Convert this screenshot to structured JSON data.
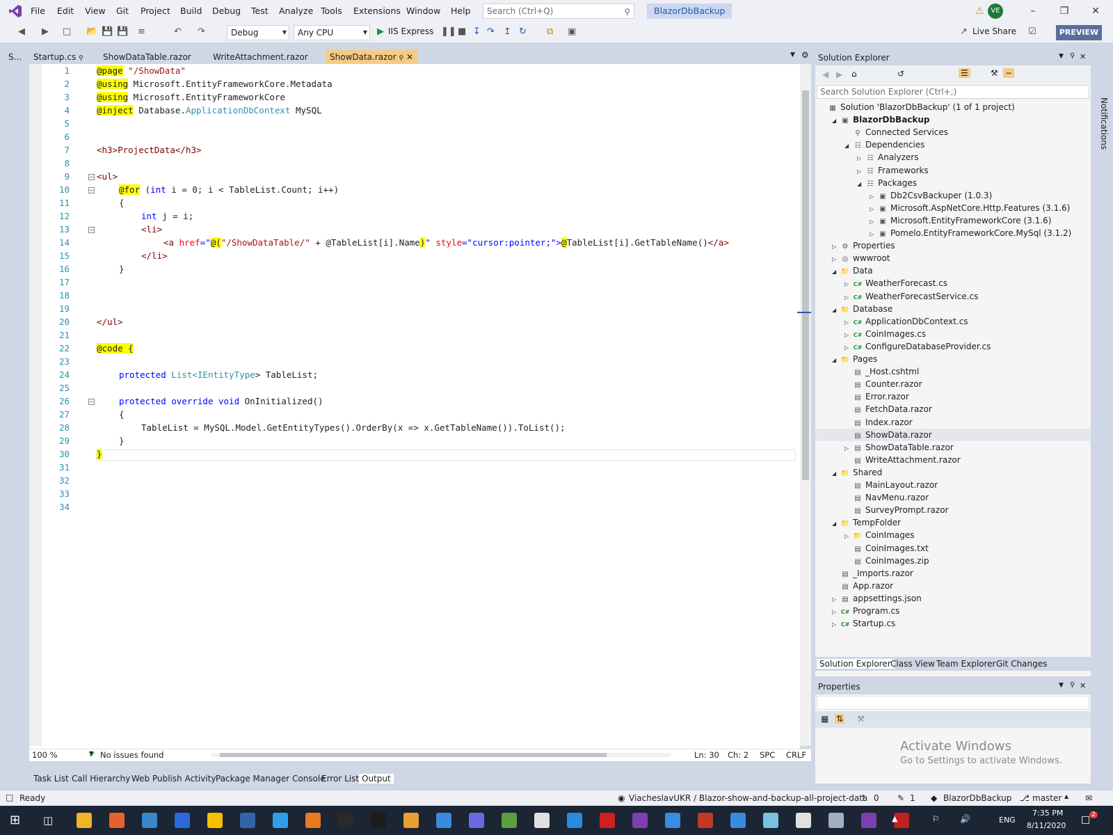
{
  "menu": [
    "File",
    "Edit",
    "View",
    "Git",
    "Project",
    "Build",
    "Debug",
    "Test",
    "Analyze",
    "Tools",
    "Extensions",
    "Window",
    "Help"
  ],
  "search": {
    "placeholder": "Search (Ctrl+Q)"
  },
  "solution_title": "BlazorDbBackup",
  "avatar": "VE",
  "toolbar": {
    "config": "Debug",
    "platform": "Any CPU",
    "run": "IIS Express",
    "live_share": "Live Share",
    "preview": "PREVIEW"
  },
  "tabs": {
    "side": "S...",
    "startup": "Startup.cs",
    "showdatatable": "ShowDataTable.razor",
    "writeattachment": "WriteAttachment.razor",
    "showdata": "ShowData.razor"
  },
  "code": {
    "l1a": "@page",
    "l1b": " \"/ShowData\"",
    "l2a": "@using",
    "l2b": " Microsoft.EntityFrameworkCore.Metadata",
    "l3a": "@using",
    "l3b": " Microsoft.EntityFrameworkCore",
    "l4a": "@inject",
    "l4b": " Database.",
    "l4c": "ApplicationDbContext",
    "l4d": " MySQL",
    "l7": "<h3>ProjectData</h3>",
    "l9": "<ul>",
    "l10a": "@for",
    "l10b": " (",
    "l10c": "int",
    "l10d": " i = 0; i < TableList.Count; i++)",
    "l11": "{",
    "l12a": "int",
    "l12b": " j = i;",
    "l13": "<li>",
    "l14a": "<a ",
    "l14b": "href",
    "l14c": "=\"",
    "l14d": "@(",
    "l14e": "\"/ShowDataTable/\"",
    "l14f": " + @TableList[i].Name",
    "l14g": ")",
    "l14h": "\" ",
    "l14i": "style",
    "l14j": "=\"",
    "l14k": "cursor:pointer;",
    "l14l": "\">",
    "l14m": "@",
    "l14n": "TableList[i].GetTableName()",
    "l14o": "</a>",
    "l15": "</li>",
    "l16": "}",
    "l20": "</ul>",
    "l22a": "@code",
    "l22b": " {",
    "l24a": "protected",
    "l24b": " List<",
    "l24c": "IEntityType",
    "l24d": "> TableList;",
    "l26a": "protected",
    "l26b": " override",
    "l26c": " void",
    "l26d": " OnInitialized()",
    "l27": "{",
    "l28": "TableList = MySQL.Model.GetEntityTypes().OrderBy(x => x.GetTableName()).ToList();",
    "l29": "}",
    "l30": "}"
  },
  "line_numbers": [
    "1",
    "2",
    "3",
    "4",
    "5",
    "6",
    "7",
    "8",
    "9",
    "10",
    "11",
    "12",
    "13",
    "14",
    "15",
    "16",
    "17",
    "18",
    "19",
    "20",
    "21",
    "22",
    "23",
    "24",
    "25",
    "26",
    "27",
    "28",
    "29",
    "30",
    "31",
    "32",
    "33",
    "34"
  ],
  "editor_status": {
    "zoom": "100 %",
    "issues": "No issues found",
    "ln": "Ln: 30",
    "ch": "Ch: 2",
    "spc": "SPC",
    "crlf": "CRLF"
  },
  "bottom_tabs": [
    "Task List",
    "Call Hierarchy",
    "Web Publish Activity",
    "Package Manager Console",
    "Error List",
    "Output"
  ],
  "solution_explorer": {
    "title": "Solution Explorer",
    "search": "Search Solution Explorer (Ctrl+;)",
    "nodes": [
      "Solution 'BlazorDbBackup' (1 of 1 project)",
      "BlazorDbBackup",
      "Connected Services",
      "Dependencies",
      "Analyzers",
      "Frameworks",
      "Packages",
      "Db2CsvBackuper (1.0.3)",
      "Microsoft.AspNetCore.Http.Features (3.1.6)",
      "Microsoft.EntityFrameworkCore (3.1.6)",
      "Pomelo.EntityFrameworkCore.MySql (3.1.2)",
      "Properties",
      "wwwroot",
      "Data",
      "WeatherForecast.cs",
      "WeatherForecastService.cs",
      "Database",
      "ApplicationDbContext.cs",
      "CoinImages.cs",
      "ConfigureDatabaseProvider.cs",
      "Pages",
      "_Host.cshtml",
      "Counter.razor",
      "Error.razor",
      "FetchData.razor",
      "Index.razor",
      "ShowData.razor",
      "ShowDataTable.razor",
      "WriteAttachment.razor",
      "Shared",
      "MainLayout.razor",
      "NavMenu.razor",
      "SurveyPrompt.razor",
      "TempFolder",
      "CoinImages",
      "CoinImages.txt",
      "CoinImages.zip",
      "_Imports.razor",
      "App.razor",
      "appsettings.json",
      "Program.cs",
      "Startup.cs"
    ],
    "tabs": [
      "Solution Explorer",
      "Class View",
      "Team Explorer",
      "Git Changes"
    ]
  },
  "properties": {
    "title": "Properties"
  },
  "activate": {
    "title": "Activate Windows",
    "subtitle": "Go to Settings to activate Windows."
  },
  "notifications": "Notifications",
  "status": {
    "ready": "Ready",
    "repo": "ViacheslavUKR / Blazor-show-and-backup-all-project-data",
    "up": "0",
    "edits": "1",
    "project": "BlazorDbBackup",
    "branch": "master"
  },
  "taskbar": {
    "lang": "ENG",
    "time": "7:35 PM",
    "date": "8/11/2020",
    "notif_count": "2"
  },
  "colors": {
    "accent": "#68217a",
    "active_tab": "#f5cc84",
    "preview": "#5b6e9b"
  }
}
